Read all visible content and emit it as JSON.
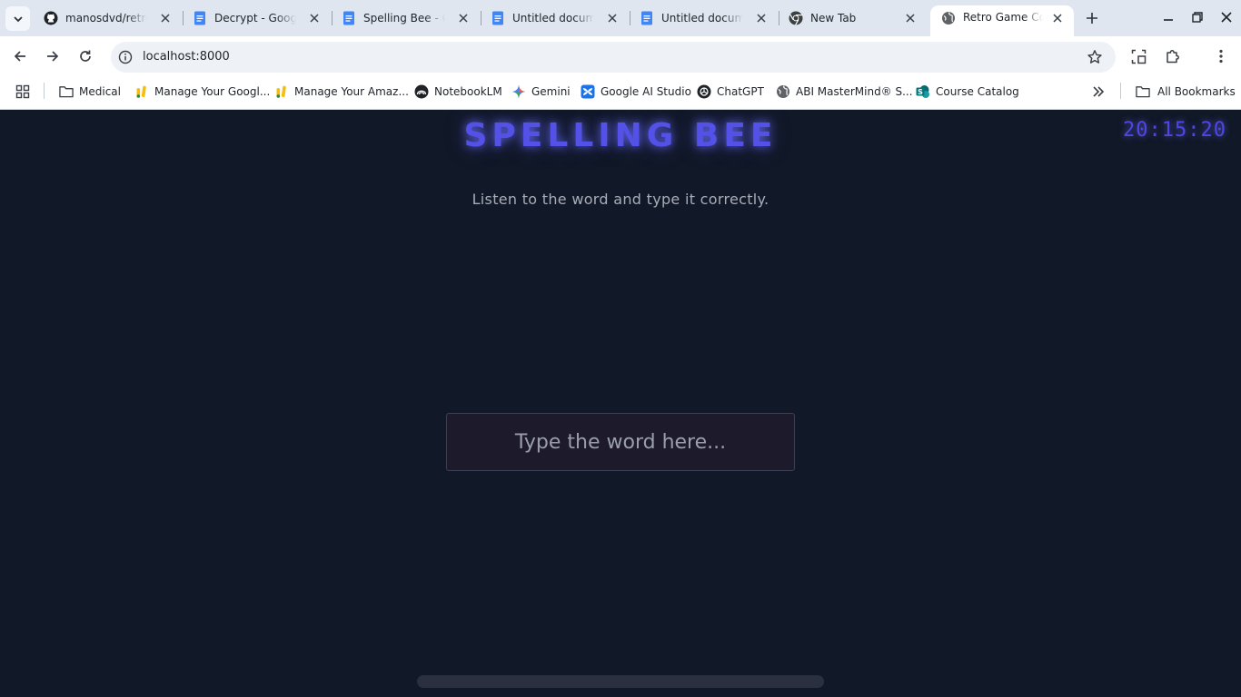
{
  "browser": {
    "tabs": [
      {
        "title": "manosdvd/retroI",
        "icon": "github-icon",
        "active": false
      },
      {
        "title": "Decrypt - Google Docs",
        "icon": "docs-icon",
        "active": false
      },
      {
        "title": "Spelling Bee - Google Docs",
        "icon": "docs-icon",
        "active": false
      },
      {
        "title": "Untitled document",
        "icon": "docs-icon",
        "active": false
      },
      {
        "title": "Untitled document",
        "icon": "docs-icon",
        "active": false
      },
      {
        "title": "New Tab",
        "icon": "chrome-icon",
        "active": false
      },
      {
        "title": "Retro Game Collection",
        "icon": "globe-icon",
        "active": true
      }
    ],
    "url": "localhost:8000",
    "bookmarks": [
      {
        "label": "Medical",
        "icon": "folder-icon"
      },
      {
        "label": "Manage Your Googl...",
        "icon": "ads-icon"
      },
      {
        "label": "Manage Your Amaz...",
        "icon": "ads-icon"
      },
      {
        "label": "NotebookLM",
        "icon": "notebooklm-icon"
      },
      {
        "label": "Gemini",
        "icon": "gemini-icon"
      },
      {
        "label": "Google AI Studio",
        "icon": "ai-studio-icon"
      },
      {
        "label": "ChatGPT",
        "icon": "chatgpt-icon"
      },
      {
        "label": "ABI MasterMind® S...",
        "icon": "globe-icon"
      },
      {
        "label": "Course Catalog",
        "icon": "sharepoint-icon"
      }
    ],
    "all_bookmarks_label": "All Bookmarks"
  },
  "game": {
    "title": "SPELLING BEE",
    "clock": "20:15:20",
    "instructions": "Listen to the word and type it correctly.",
    "input_placeholder": "Type the word here...",
    "input_value": "",
    "accent_color": "#6366f1",
    "background_color": "#111827"
  }
}
